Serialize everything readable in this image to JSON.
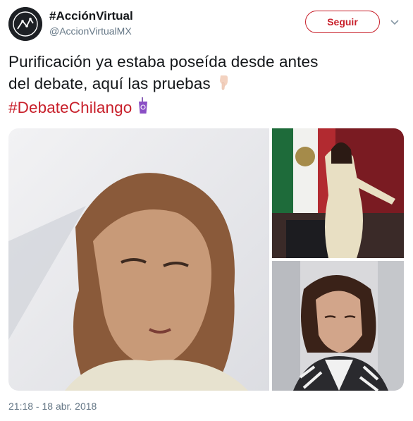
{
  "account": {
    "name": "#AcciónVirtual",
    "handle": "@AccionVirtualMX",
    "avatar_icon": "line-chart-logo-icon"
  },
  "actions": {
    "follow_label": "Seguir",
    "menu_icon": "chevron-down-icon"
  },
  "tweet": {
    "text_line1": "Purificación ya estaba poseída desde antes",
    "text_line2": "del debate, aquí las pruebas",
    "hashtag": "#DebateChilango",
    "emoji_1": "pointing-down-hand-icon",
    "emoji_2": "purple-cup-icon"
  },
  "media": {
    "photos": [
      {
        "name": "photo-woman-close-up"
      },
      {
        "name": "photo-woman-at-podium"
      },
      {
        "name": "photo-woman-looking-down"
      }
    ]
  },
  "timestamp": "21:18 - 18 abr. 2018",
  "colors": {
    "accent": "#c8202b",
    "text": "#14171a",
    "secondary_text": "#657786"
  }
}
